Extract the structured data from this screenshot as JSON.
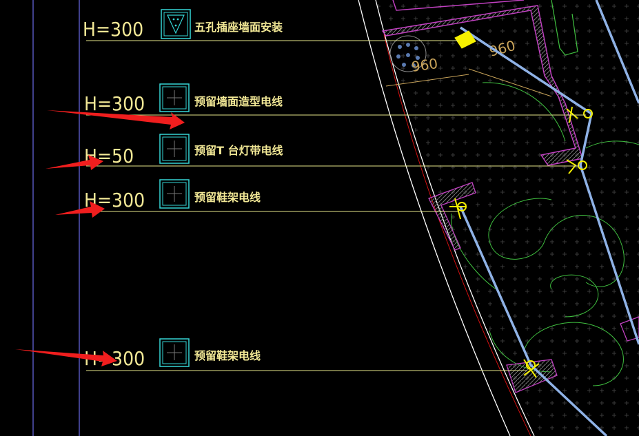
{
  "colors": {
    "background": "#000000",
    "text": "#f2e896",
    "leader_line": "#e6e68a",
    "wall_outline": "#ffffff",
    "vertical_guide": "#6a6ae8",
    "symbol_cyan": "#35d6d6",
    "magenta_wall": "#c040c0",
    "green_arc": "#40c040",
    "cable_blue": "#8fb2e6",
    "socket_yellow": "#f5f000",
    "arrow_red": "#f01e1e",
    "dim_line": "#c9a45a",
    "hatch_red": "#d01010"
  },
  "annotations": [
    {
      "height_label": "H=300",
      "note": "五孔插座墙面安装",
      "symbol": "five-hole-socket-icon"
    },
    {
      "height_label": "H=300",
      "note": "预留墙面造型电线",
      "symbol": "reserved-box-icon"
    },
    {
      "height_label": "H=50",
      "note": "预留T 台灯带电线",
      "symbol": "reserved-box-icon"
    },
    {
      "height_label": "H=300",
      "note": "预留鞋架电线",
      "symbol": "reserved-box-icon"
    },
    {
      "height_label": "H=300",
      "note": "预留鞋架电线",
      "symbol": "reserved-box-icon"
    }
  ],
  "dimensions": [
    "960",
    "960"
  ],
  "arrows_count": 4
}
